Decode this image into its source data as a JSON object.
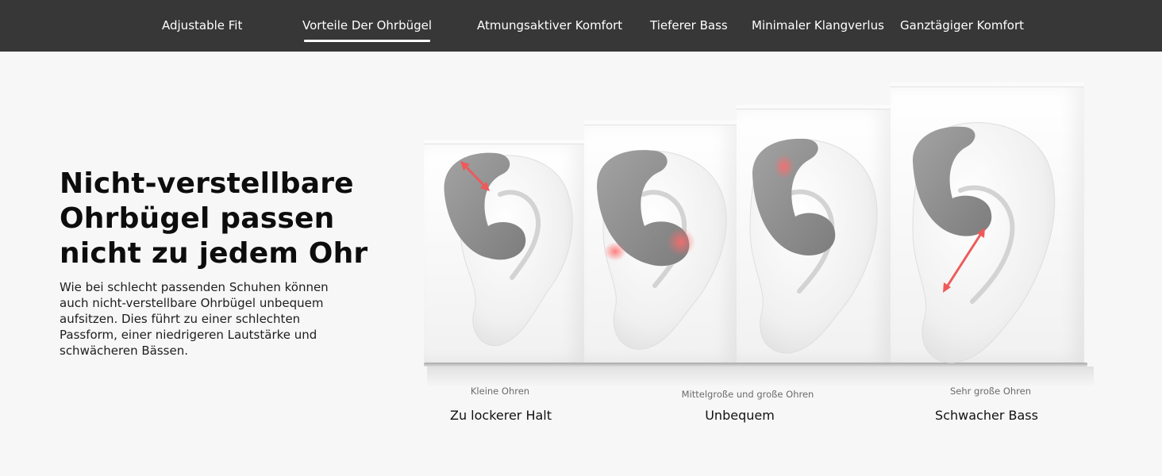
{
  "nav": {
    "tabs": [
      {
        "label": "Adjustable Fit",
        "active": false
      },
      {
        "label": "Vorteile Der Ohrbügel",
        "active": true
      },
      {
        "label": "Atmungsaktiver Komfort",
        "active": false
      },
      {
        "label": "Tieferer Bass",
        "active": false
      },
      {
        "label": "Minimaler Klangverlus",
        "active": false
      },
      {
        "label": "Ganztägiger Komfort",
        "active": false
      }
    ]
  },
  "hero": {
    "headline_lines": [
      "Nicht-verstellbare",
      "Ohrbügel passen",
      "nicht zu jedem Ohr"
    ],
    "description_lines": [
      "Wie bei schlecht passenden Schuhen können",
      "auch nicht-verstellbare Ohrbügel unbequem",
      "aufsitzen. Dies führt zu einer schlechten",
      "Passform, einer niedrigeren Lautstärke und",
      "schwächeren Bässen."
    ]
  },
  "comparison": {
    "items": [
      {
        "size": "Kleine Ohren",
        "result": "Zu lockerer Halt"
      },
      {
        "size": "Mittelgroße und große Ohren",
        "result": "Unbequem"
      },
      {
        "size": "Sehr große Ohren",
        "result": "Schwacher Bass"
      }
    ]
  },
  "colors": {
    "nav_background": "#373737",
    "page_background": "#f7f7f7",
    "earhook_gray": "#8f8f8f",
    "highlight_red": "#ee5a5a"
  }
}
